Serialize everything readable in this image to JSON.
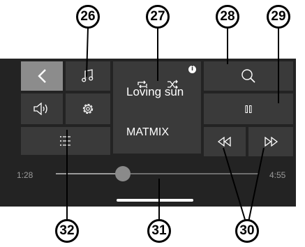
{
  "callouts": {
    "c26": "26",
    "c27": "27",
    "c28": "28",
    "c29": "29",
    "c30": "30",
    "c31": "31",
    "c32": "32"
  },
  "now_playing": {
    "song": "Loving sun",
    "artist": "MATMIX"
  },
  "progress": {
    "elapsed": "1:28",
    "total": "4:55",
    "fraction": 0.33
  },
  "icons": {
    "back": "back-arrow-icon",
    "music": "music-note-icon",
    "volume": "speaker-icon",
    "settings": "gear-icon",
    "list": "list-icon",
    "info": "info-icon",
    "search": "search-icon",
    "pause": "pause-icon",
    "rewind": "rewind-icon",
    "forward": "fast-forward-icon",
    "repeat": "repeat-icon",
    "shuffle": "shuffle-icon"
  },
  "info_glyph": "i",
  "colors": {
    "panel": "#232323",
    "tile": "#3a3a3a",
    "active_tile": "#8c8c8c",
    "knob": "#8a8a8a"
  }
}
